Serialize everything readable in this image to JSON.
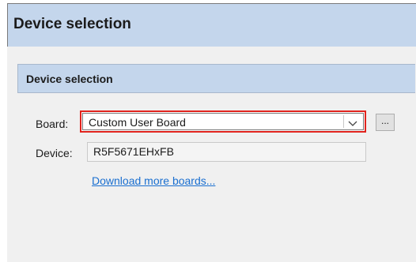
{
  "header": {
    "title": "Device selection"
  },
  "section": {
    "title": "Device selection"
  },
  "board": {
    "label": "Board:",
    "selected": "Custom User Board",
    "browse_label": "..."
  },
  "device": {
    "label": "Device:",
    "value": "R5F5671EHxFB"
  },
  "links": {
    "download_more_boards": "Download more boards..."
  },
  "colors": {
    "header_bg": "#c4d6ec",
    "highlight_border": "#e0231d",
    "link": "#1a6fd0"
  },
  "icons": {
    "dropdown": "chevron-down-icon"
  }
}
